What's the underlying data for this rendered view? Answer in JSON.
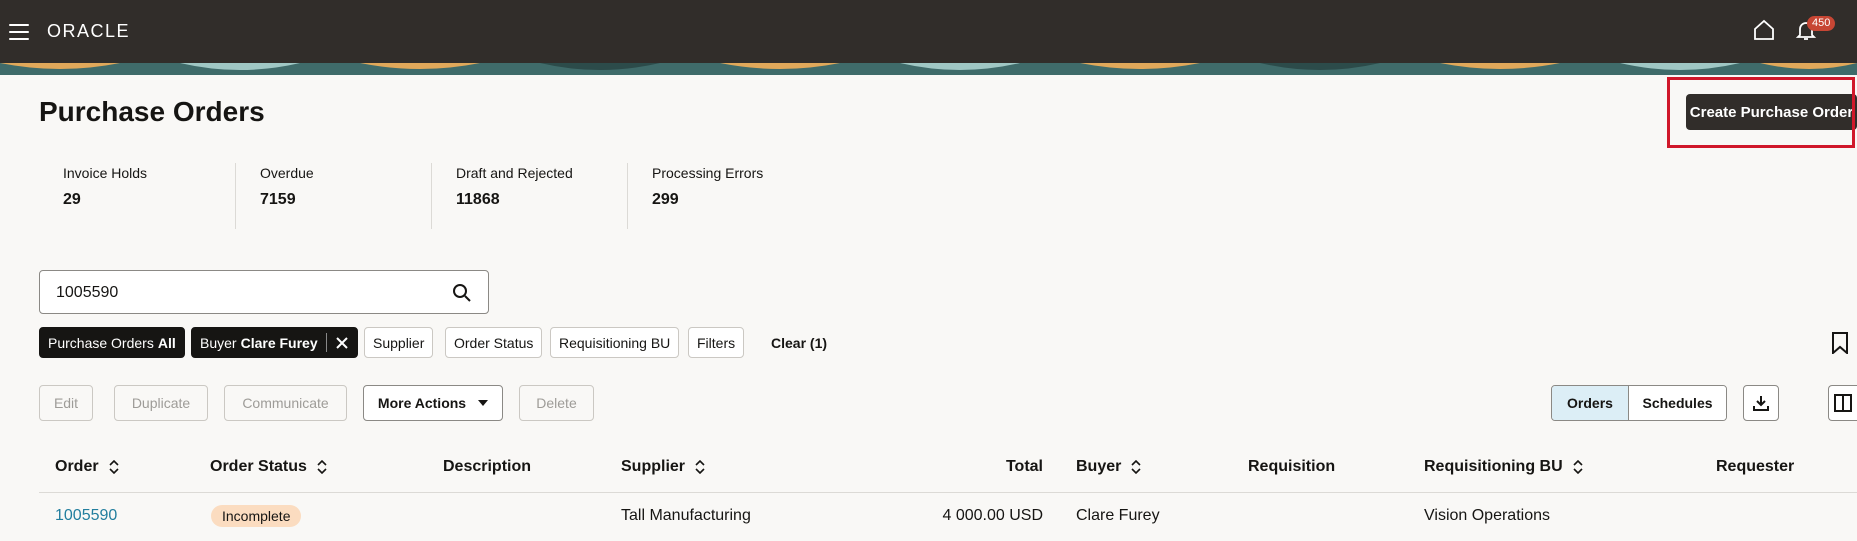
{
  "header": {
    "brand": "ORACLE",
    "notification_count": "450"
  },
  "page": {
    "title": "Purchase Orders",
    "create_button": "Create Purchase Order"
  },
  "metrics": [
    {
      "label": "Invoice Holds",
      "value": "29"
    },
    {
      "label": "Overdue",
      "value": "7159"
    },
    {
      "label": "Draft and Rejected",
      "value": "11868"
    },
    {
      "label": "Processing Errors",
      "value": "299"
    }
  ],
  "search": {
    "value": "1005590"
  },
  "filters": {
    "po_prefix": "Purchase Orders",
    "po_value": "All",
    "buyer_prefix": "Buyer",
    "buyer_value": "Clare Furey",
    "supplier": "Supplier",
    "order_status": "Order Status",
    "req_bu": "Requisitioning BU",
    "filters": "Filters",
    "clear": "Clear (1)"
  },
  "actions": {
    "edit": "Edit",
    "duplicate": "Duplicate",
    "communicate": "Communicate",
    "more": "More Actions",
    "delete": "Delete",
    "view_orders": "Orders",
    "view_schedules": "Schedules"
  },
  "table": {
    "columns": [
      "Order",
      "Order Status",
      "Description",
      "Supplier",
      "Total",
      "Buyer",
      "Requisition",
      "Requisitioning BU",
      "Requester"
    ],
    "rows": [
      {
        "order": "1005590",
        "status": "Incomplete",
        "description": "",
        "supplier": "Tall Manufacturing",
        "total": "4 000.00 USD",
        "buyer": "Clare Furey",
        "requisition": "",
        "req_bu": "Vision Operations",
        "requester": ""
      }
    ]
  },
  "colors": {
    "header_bg": "#312d2a",
    "highlight": "#d0182a",
    "badge": "#c74634",
    "status_pill": "#fbdcc0",
    "link": "#227e9e"
  }
}
